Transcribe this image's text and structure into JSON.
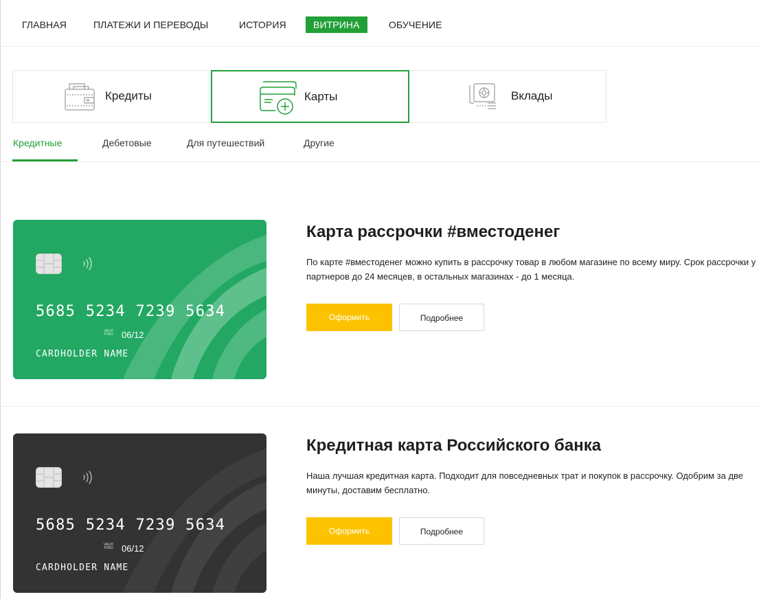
{
  "nav": {
    "items": [
      {
        "label": "ГЛАВНАЯ"
      },
      {
        "label": "ПЛАТЕЖИ И ПЕРЕВОДЫ"
      },
      {
        "label": "ИСТОРИЯ"
      },
      {
        "label": "ВИТРИНА",
        "active": true
      },
      {
        "label": "ОБУЧЕНИЕ"
      }
    ]
  },
  "categories": [
    {
      "label": "Кредиты",
      "icon": "wallet-icon"
    },
    {
      "label": "Карты",
      "icon": "card-add-icon",
      "active": true
    },
    {
      "label": "Вклады",
      "icon": "safe-icon"
    }
  ],
  "subtabs": [
    {
      "label": "Кредитные",
      "active": true
    },
    {
      "label": "Дебетовые"
    },
    {
      "label": "Для путешествий"
    },
    {
      "label": "Другие"
    }
  ],
  "products": [
    {
      "title": "Карта рассрочки #вместоденег",
      "description": "По карте #вместоденег можно купить в рассрочку товар в любом магазине по всему миру. Срок рассрочки у партнеров до 24 месяцев, в остальных магазинах - до 1 месяца.",
      "apply_label": "Оформить",
      "details_label": "Подробнее",
      "card": {
        "number": "5685 5234 7239 5634",
        "valid_label": "VALID THRU",
        "expiry": "06/12",
        "holder": "CARDHOLDER NAME",
        "color": "#22a862"
      }
    },
    {
      "title": "Кредитная карта Российского банка",
      "description": "Наша лучшая кредитная карта. Подходит для повседневных трат и покупок в рассрочку. Одобрим за две минуты, доставим бесплатно.",
      "apply_label": "Оформить",
      "details_label": "Подробнее",
      "card": {
        "number": "5685 5234 7239 5634",
        "valid_label": "VALID THRU",
        "expiry": "06/12",
        "holder": "CARDHOLDER NAME",
        "color": "#333333"
      }
    }
  ],
  "colors": {
    "accent": "#21a038",
    "primary_button": "#fcc200"
  }
}
